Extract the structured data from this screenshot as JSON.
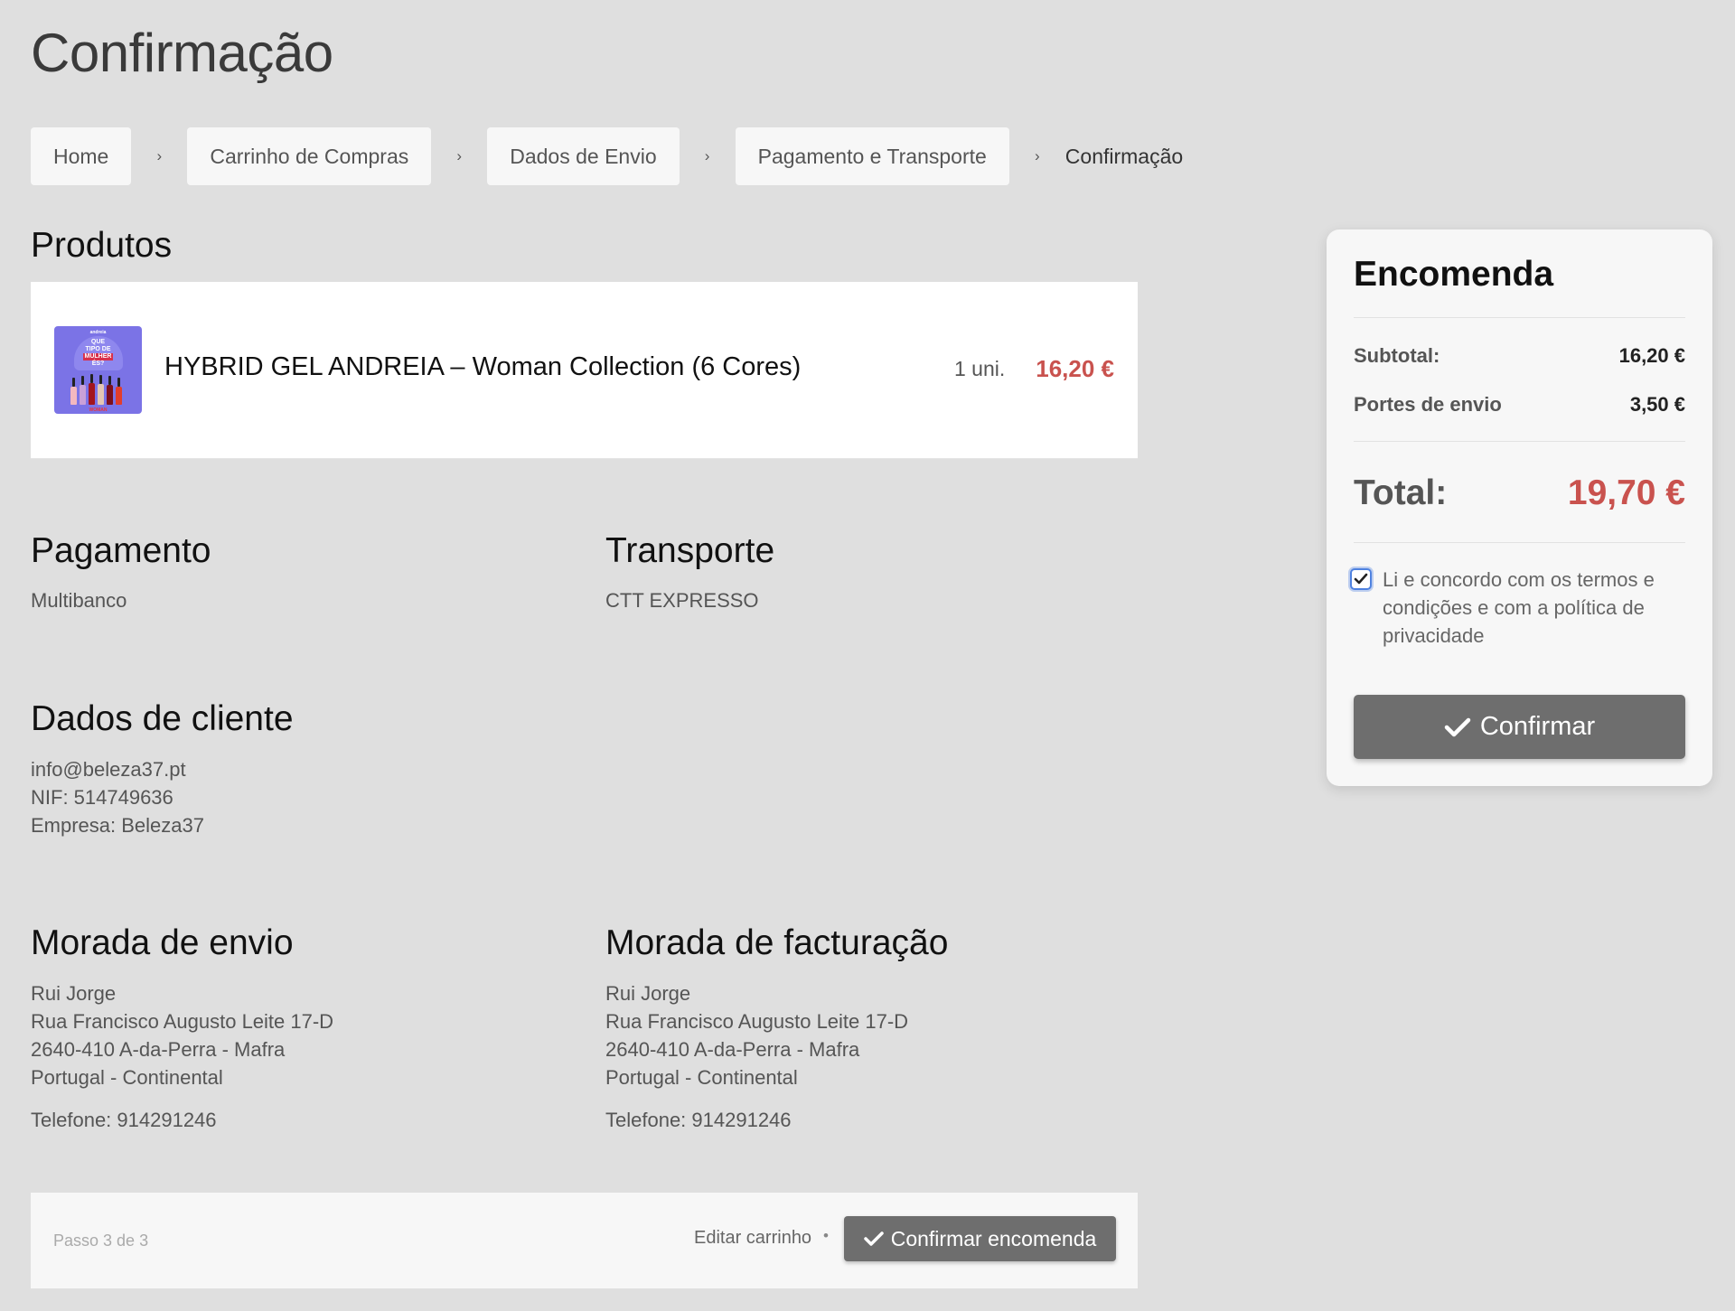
{
  "page": {
    "title": "Confirmação"
  },
  "breadcrumb": {
    "items": [
      {
        "label": "Home"
      },
      {
        "label": "Carrinho de Compras"
      },
      {
        "label": "Dados de Envio"
      },
      {
        "label": "Pagamento e Transporte"
      }
    ],
    "current": "Confirmação",
    "separator": "›"
  },
  "products": {
    "heading": "Produtos",
    "items": [
      {
        "name": "HYBRID GEL ANDREIA – Woman Collection (6 Cores)",
        "qty": "1 uni.",
        "price": "16,20 €",
        "image": {
          "top": "andreia",
          "line1": "QUE",
          "line2": "TIPO DE",
          "line3": "MULHER",
          "line4": "ÉS?",
          "foot": "WOMAN"
        }
      }
    ]
  },
  "payment": {
    "heading": "Pagamento",
    "value": "Multibanco"
  },
  "transport": {
    "heading": "Transporte",
    "value": "CTT EXPRESSO"
  },
  "customer": {
    "heading": "Dados de cliente",
    "lines": [
      "info@beleza37.pt",
      "NIF: 514749636",
      "Empresa: Beleza37"
    ]
  },
  "shipping_address": {
    "heading": "Morada de envio",
    "lines": [
      "Rui Jorge",
      "Rua Francisco Augusto Leite 17-D",
      "2640-410 A-da-Perra - Mafra",
      "Portugal - Continental"
    ],
    "phone": "Telefone: 914291246"
  },
  "billing_address": {
    "heading": "Morada de facturação",
    "lines": [
      "Rui Jorge",
      "Rua Francisco Augusto Leite 17-D",
      "2640-410 A-da-Perra - Mafra",
      "Portugal - Continental"
    ],
    "phone": "Telefone: 914291246"
  },
  "footer": {
    "step": "Passo 3 de 3",
    "edit_label": "Editar carrinho",
    "separator": "•",
    "confirm_label": "Confirmar encomenda",
    "confirm_icon": "check-icon"
  },
  "order": {
    "title": "Encomenda",
    "subtotal_label": "Subtotal:",
    "subtotal_value": "16,20 €",
    "shipping_label": "Portes de envio",
    "shipping_value": "3,50 €",
    "total_label": "Total:",
    "total_value": "19,70 €",
    "terms_checked": true,
    "terms_text": "Li e concordo com os termos e condições e com a política de privacidade",
    "confirm_label": "Confirmar",
    "confirm_icon": "check-icon"
  },
  "colors": {
    "background": "#dfdfdf",
    "price_accent": "#c9524e",
    "button": "#6e6e6e",
    "card": "#f7f7f7",
    "checkbox_focus": "#4f82e0"
  }
}
